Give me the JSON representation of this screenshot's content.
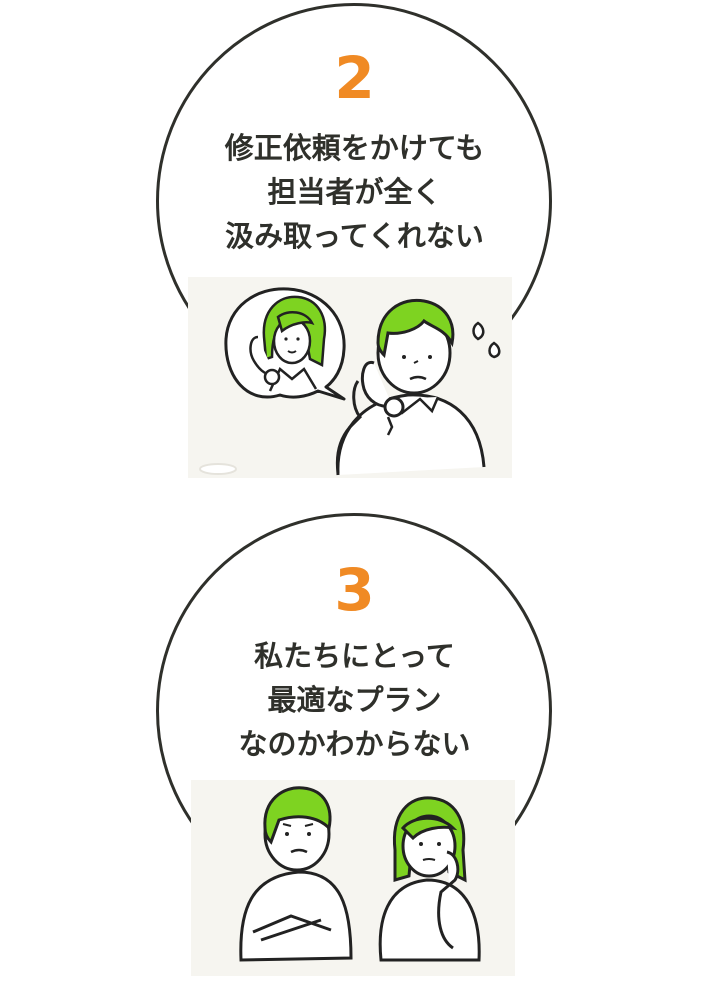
{
  "accent_color": "#f08a24",
  "hair_color": "#7ed321",
  "text_color": "#2f302b",
  "items": [
    {
      "number": "2",
      "lines": [
        "修正依頼をかけても",
        "担当者が全く",
        "汲み取ってくれない"
      ]
    },
    {
      "number": "3",
      "lines": [
        "私たちにとって",
        "最適なプラン",
        "なのかわからない"
      ]
    }
  ]
}
